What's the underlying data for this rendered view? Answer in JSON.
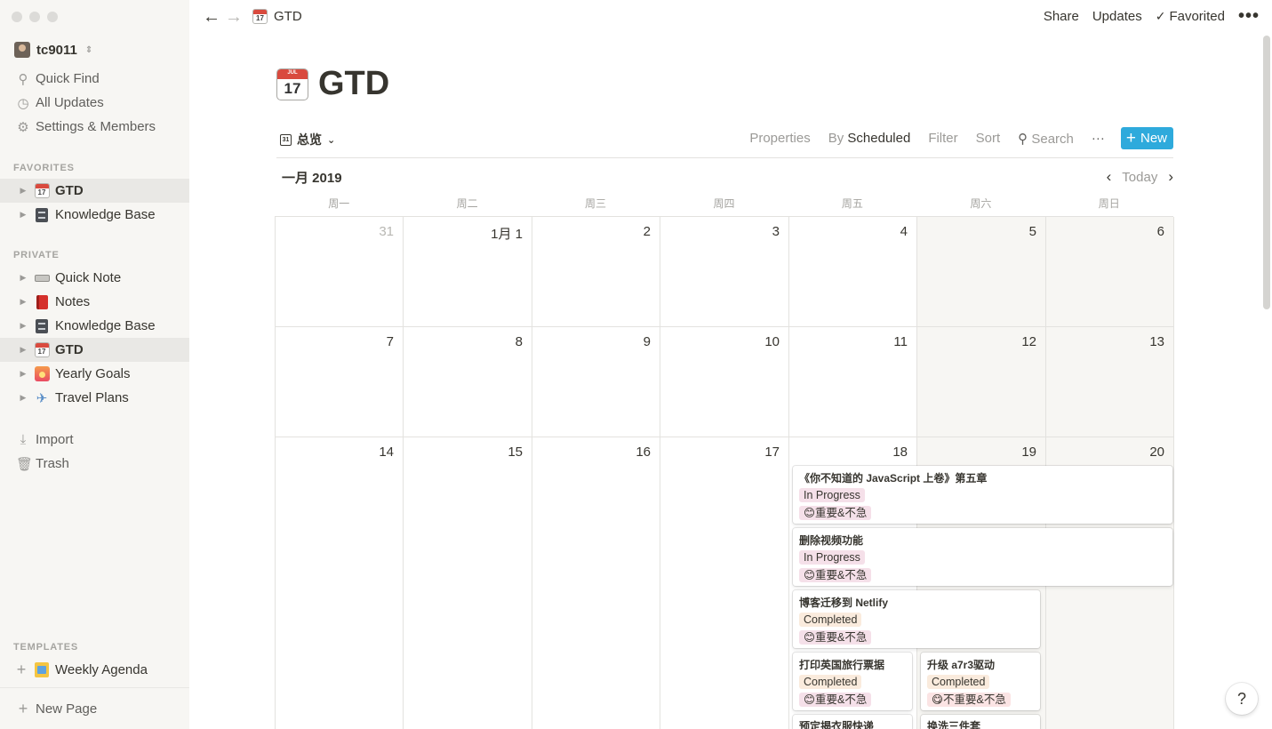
{
  "workspace": {
    "name": "tc9011"
  },
  "sidebar": {
    "top": [
      {
        "label": "Quick Find",
        "icon": "search-icon"
      },
      {
        "label": "All Updates",
        "icon": "clock-icon"
      },
      {
        "label": "Settings & Members",
        "icon": "gear-icon"
      }
    ],
    "favorites_heading": "FAVORITES",
    "favorites": [
      {
        "label": "GTD",
        "icon": "calendar-icon",
        "cal_day": "17",
        "active": true
      },
      {
        "label": "Knowledge Base",
        "icon": "file-cabinet-icon"
      }
    ],
    "private_heading": "PRIVATE",
    "private": [
      {
        "label": "Quick Note",
        "icon": "keyboard-icon"
      },
      {
        "label": "Notes",
        "icon": "red-book-icon"
      },
      {
        "label": "Knowledge Base",
        "icon": "file-cabinet-icon"
      },
      {
        "label": "GTD",
        "icon": "calendar-icon",
        "cal_day": "17",
        "active": true
      },
      {
        "label": "Yearly Goals",
        "icon": "sunrise-icon"
      },
      {
        "label": "Travel Plans",
        "icon": "airplane-icon"
      }
    ],
    "import_label": "Import",
    "trash_label": "Trash",
    "templates_heading": "TEMPLATES",
    "template_item": {
      "label": "Weekly Agenda",
      "icon": "notepad-icon"
    },
    "new_page_label": "New Page"
  },
  "topbar": {
    "breadcrumb": "GTD",
    "share": "Share",
    "updates": "Updates",
    "favorited": "Favorited",
    "more": "•••"
  },
  "page": {
    "title": "GTD",
    "icon_month": "JUL",
    "icon_day": "17"
  },
  "view": {
    "name": "总览",
    "view_icon_text": "31",
    "properties": "Properties",
    "by_label": "By",
    "by_value": "Scheduled",
    "filter": "Filter",
    "sort": "Sort",
    "search": "Search",
    "more": "···",
    "new": "New"
  },
  "calendar": {
    "month_label": "一月 2019",
    "today": "Today",
    "weekdays": [
      "周一",
      "周二",
      "周三",
      "周四",
      "周五",
      "周六",
      "周日"
    ],
    "weeks": [
      [
        "31",
        "1月 1",
        "2",
        "3",
        "4",
        "5",
        "6"
      ],
      [
        "7",
        "8",
        "9",
        "10",
        "11",
        "12",
        "13"
      ],
      [
        "14",
        "15",
        "16",
        "17",
        "18",
        "19",
        "20"
      ]
    ],
    "events": [
      {
        "title": "《你不知道的 JavaScript 上卷》第五章",
        "status": "In Progress",
        "priority": "😊重要&不急"
      },
      {
        "title": "删除视频功能",
        "status": "In Progress",
        "priority": "😊重要&不急"
      },
      {
        "title": "博客迁移到 Netlify",
        "status": "Completed",
        "priority": "😊重要&不急"
      },
      {
        "title": "打印英国旅行票据",
        "status": "Completed",
        "priority": "😊重要&不急"
      },
      {
        "title": "升级 a7r3驱动",
        "status": "Completed",
        "priority": "😋不重要&不急"
      },
      {
        "title": "预定揭衣服快递",
        "status": "",
        "priority": ""
      },
      {
        "title": "换洗三件套",
        "status": "",
        "priority": ""
      }
    ]
  },
  "help": "?"
}
